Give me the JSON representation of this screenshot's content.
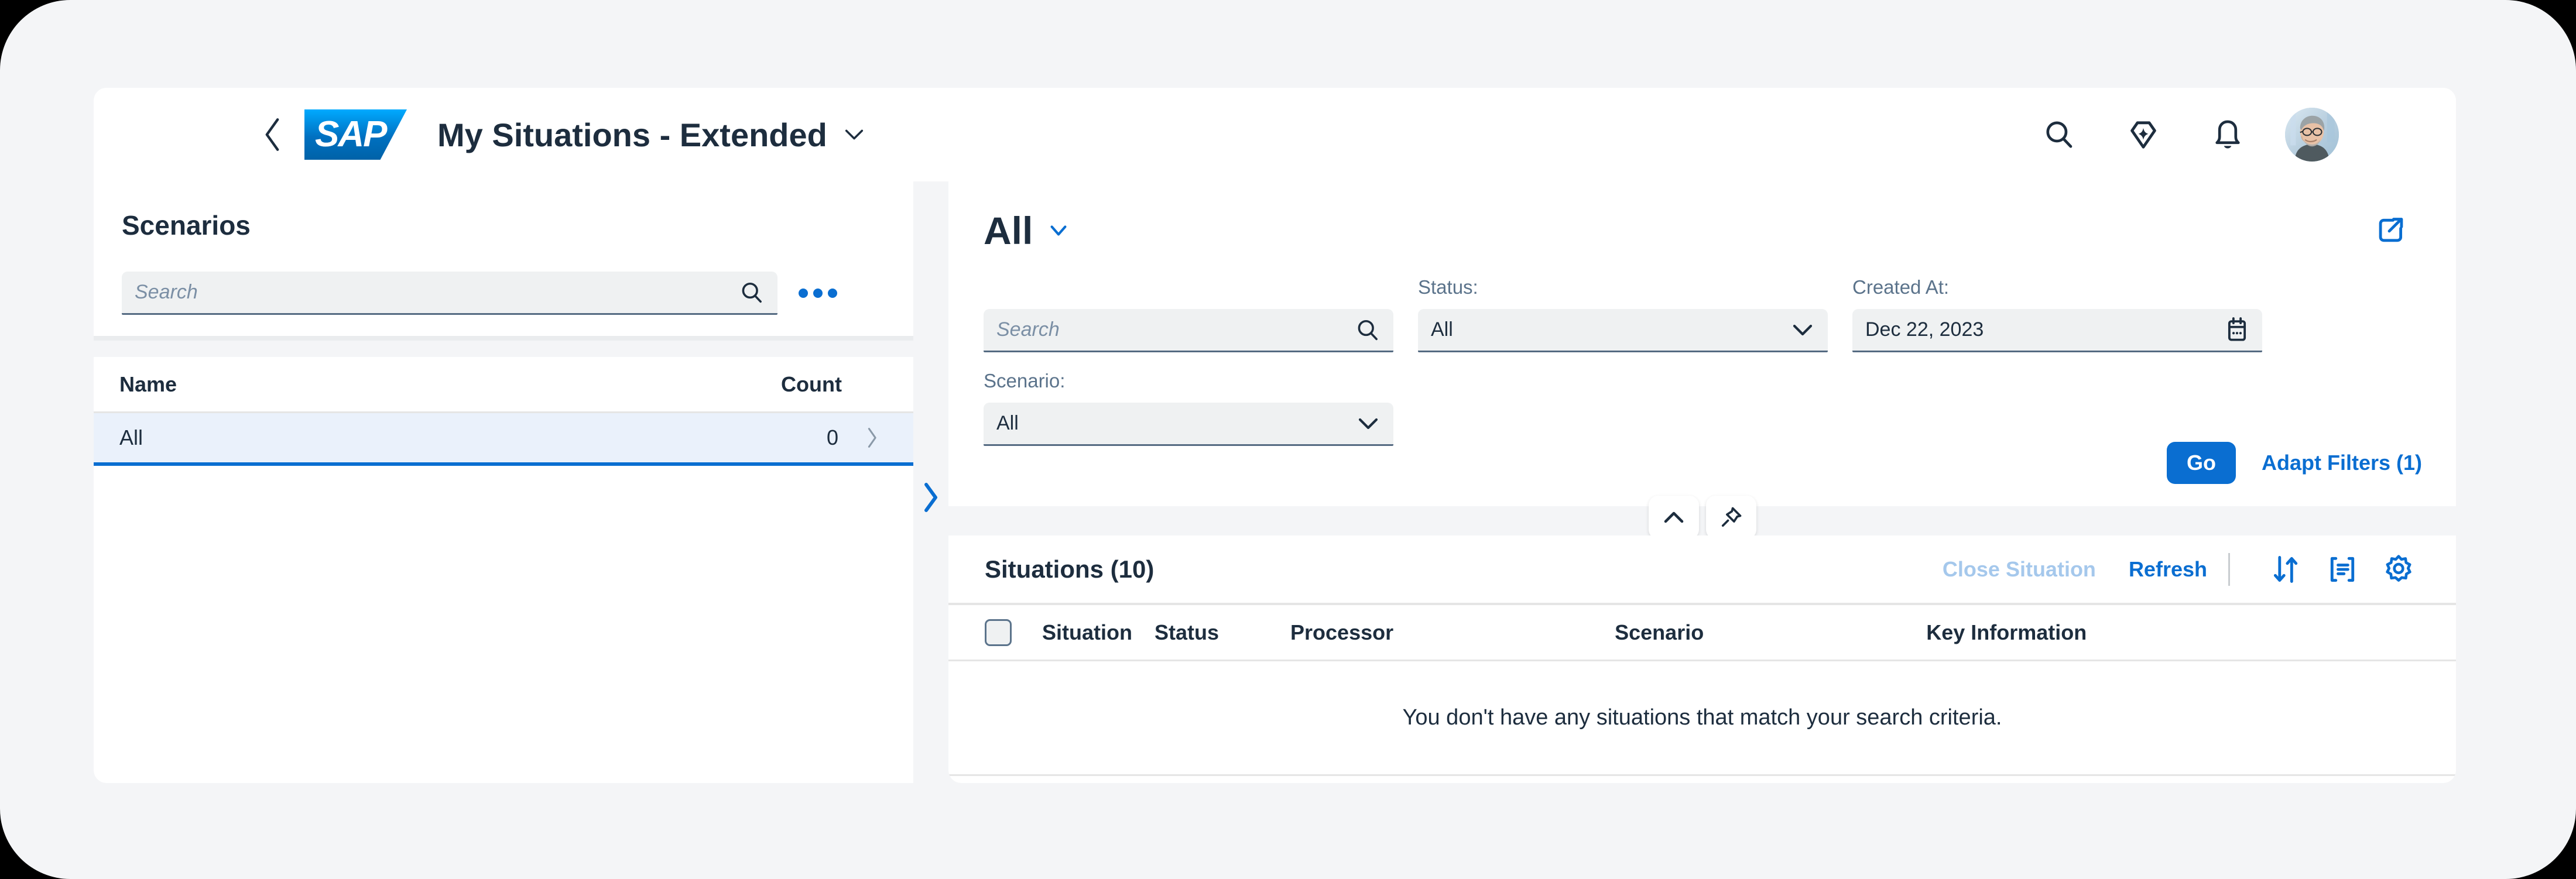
{
  "shell": {
    "back_label": "Back",
    "logo_text": "SAP",
    "title": "My Situations - Extended",
    "title_chevron": "chevron-down",
    "actions": [
      {
        "name": "search",
        "label": "Search"
      },
      {
        "name": "joule",
        "label": "Joule"
      },
      {
        "name": "notifications",
        "label": "Notifications"
      },
      {
        "name": "avatar",
        "label": "User Profile"
      }
    ]
  },
  "sidebar": {
    "title": "Scenarios",
    "search": {
      "placeholder": "Search",
      "value": ""
    },
    "more_label": "More",
    "columns": {
      "name": "Name",
      "count": "Count"
    },
    "rows": [
      {
        "name": "All",
        "count": "0",
        "selected": true
      }
    ]
  },
  "main": {
    "variant": {
      "title": "All",
      "chevron": "chevron-down"
    },
    "share_label": "Share",
    "filters": {
      "search": {
        "label": "",
        "placeholder": "Search",
        "value": ""
      },
      "status": {
        "label": "Status:",
        "value": "All"
      },
      "created_at": {
        "label": "Created At:",
        "value": "Dec 22, 2023"
      },
      "scenario": {
        "label": "Scenario:",
        "value": "All"
      }
    },
    "go_label": "Go",
    "adapt_filters_label": "Adapt Filters (1)",
    "strip": {
      "collapse_label": "Collapse",
      "pin_label": "Pin"
    },
    "table": {
      "title": "Situations (10)",
      "actions": {
        "close_situation": "Close Situation",
        "refresh": "Refresh"
      },
      "icons": {
        "sort": "sort-icon",
        "group": "group-icon",
        "settings": "settings-icon"
      },
      "columns": [
        "Situation",
        "Status",
        "Processor",
        "Scenario",
        "Key Information"
      ],
      "empty_message": "You don't have any situations that match your search criteria."
    }
  },
  "colors": {
    "accent": "#0a6ed1",
    "accent_disabled": "#a5c8ec",
    "text": "#1d2d3e",
    "label": "#5b738b",
    "background": "#f4f5f7",
    "selected_row": "#eaf1fb"
  }
}
